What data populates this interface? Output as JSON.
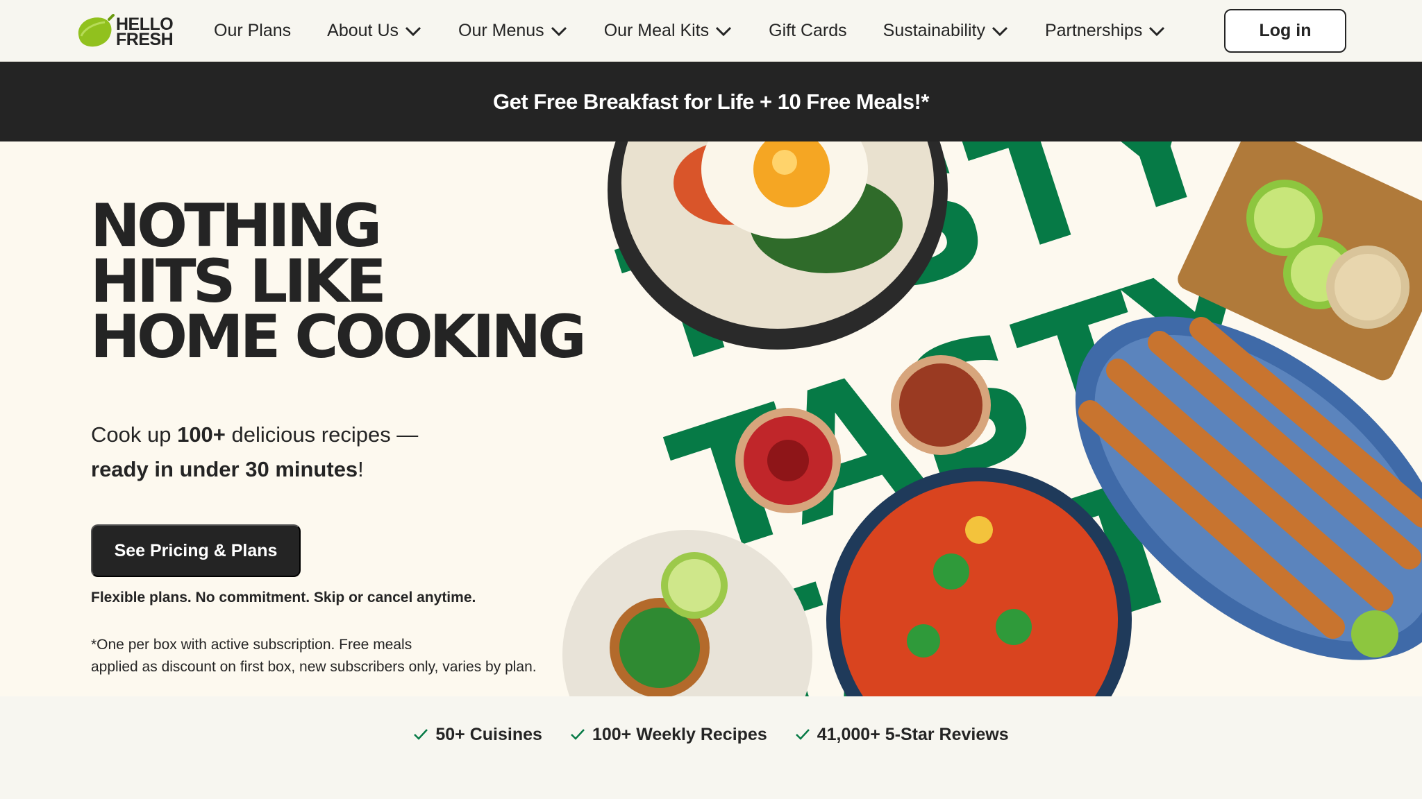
{
  "brand": {
    "logo_line1": "HELLO",
    "logo_line2": "FRESH",
    "accent": "#91c11e",
    "green": "#067a46"
  },
  "nav": {
    "items": [
      {
        "label": "Our Plans",
        "dropdown": false
      },
      {
        "label": "About Us",
        "dropdown": true
      },
      {
        "label": "Our Menus",
        "dropdown": true
      },
      {
        "label": "Our Meal Kits",
        "dropdown": true
      },
      {
        "label": "Gift Cards",
        "dropdown": false
      },
      {
        "label": "Sustainability",
        "dropdown": true
      },
      {
        "label": "Partnerships",
        "dropdown": true
      }
    ],
    "login_label": "Log in"
  },
  "promo": {
    "text": "Get Free Breakfast for Life + 10 Free Meals!*"
  },
  "hero": {
    "title_lines": [
      "NOTHING",
      "HITS LIKE",
      "HOME COOKING"
    ],
    "sub_pre": "Cook up ",
    "sub_bold1": "100+",
    "sub_mid": " delicious recipes  —",
    "sub_bold2": "ready in under 30 minutes",
    "sub_end": "!",
    "cta_label": "See Pricing & Plans",
    "flex_note": "Flexible plans. No commitment. Skip or cancel anytime.",
    "fine_line1": "*One per box with active subscription. Free meals",
    "fine_line2": "applied as discount on first box, new subscribers only, varies by plan.",
    "art_words": [
      "TASTY",
      "TASTY",
      "TASTY"
    ]
  },
  "features": [
    {
      "label": "50+ Cuisines",
      "icon": "check-icon"
    },
    {
      "label": "100+ Weekly Recipes",
      "icon": "check-icon"
    },
    {
      "label": "41,000+ 5-Star Reviews",
      "icon": "check-icon"
    }
  ]
}
